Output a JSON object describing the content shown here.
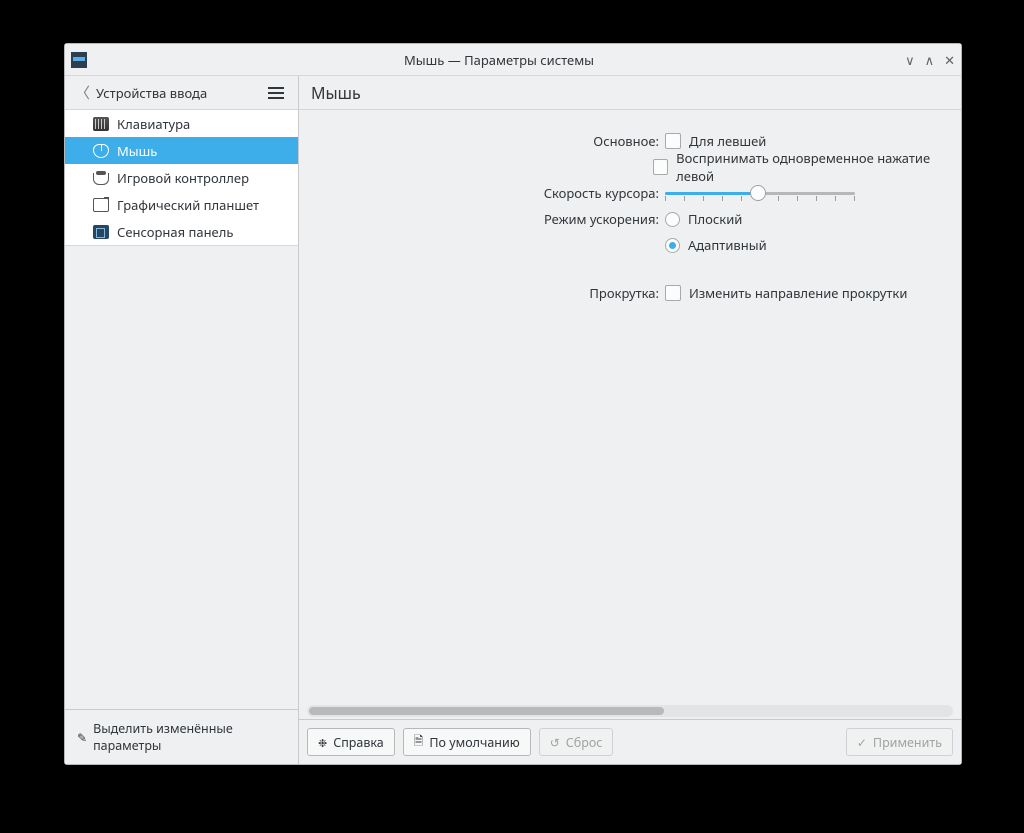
{
  "window": {
    "title": "Мышь — Параметры системы"
  },
  "sidebar": {
    "back_label": "Устройства ввода",
    "items": [
      {
        "label": "Клавиатура"
      },
      {
        "label": "Мышь"
      },
      {
        "label": "Игровой контроллер"
      },
      {
        "label": "Графический планшет"
      },
      {
        "label": "Сенсорная панель"
      }
    ],
    "highlight_btn": "Выделить изменённые параметры"
  },
  "content": {
    "title": "Мышь",
    "labels": {
      "main": "Основное:",
      "pointer_speed": "Скорость курсора:",
      "accel_mode": "Режим ускорения:",
      "scroll": "Прокрутка:"
    },
    "options": {
      "left_handed": "Для левшей",
      "simultaneous": "Воспринимать одновременное нажатие левой",
      "flat": "Плоский",
      "adaptive": "Адаптивный",
      "invert_scroll": "Изменить направление прокрутки"
    },
    "state": {
      "left_handed": false,
      "simultaneous": false,
      "accel": "adaptive",
      "invert_scroll": false,
      "speed_percent": 49
    }
  },
  "footer": {
    "help": "Справка",
    "defaults": "По умолчанию",
    "reset": "Сброс",
    "apply": "Применить"
  }
}
